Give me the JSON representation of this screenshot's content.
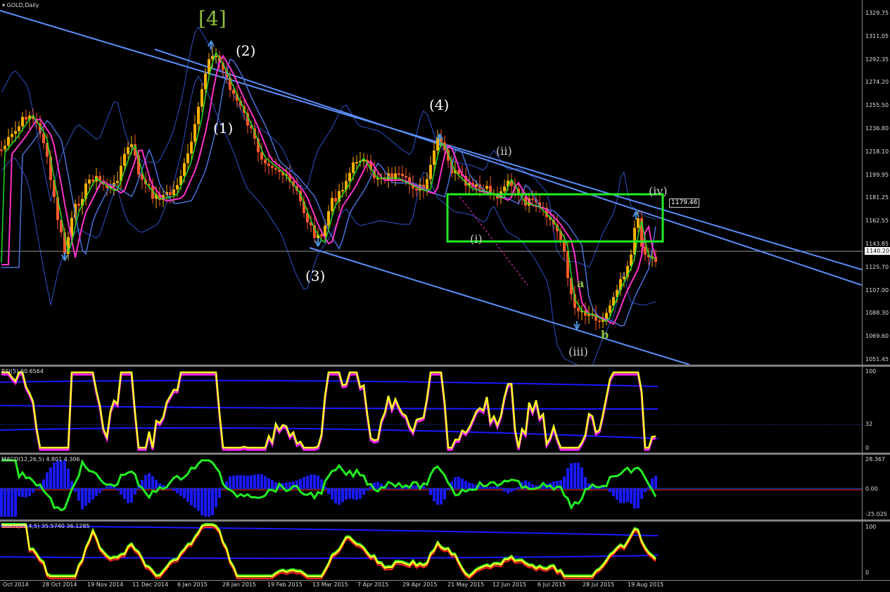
{
  "chart_title": "GOLD,Daily",
  "price_axis": [
    "1329.75",
    "1311.05",
    "1292.35",
    "1274.20",
    "1255.50",
    "1236.80",
    "1218.10",
    "1199.95",
    "1181.25",
    "1162.55",
    "1143.85",
    "1125.70",
    "1107.00",
    "1088.30",
    "1069.60",
    "1051.45"
  ],
  "current_price_label": "1140.20",
  "box_label": "1179.46",
  "wave_labels": {
    "w4_big": "[4]",
    "w2": "(2)",
    "w1": "(1)",
    "w3": "(3)",
    "w4": "(4)",
    "ii": "(ii)",
    "i": "(i)",
    "iii": "(iii)",
    "iv": "(iv)",
    "a": "a",
    "b": "b"
  },
  "rsi": {
    "label": "RSI(5) 60.6564",
    "levels": [
      "100",
      "32",
      "0"
    ]
  },
  "macd": {
    "label": "MACD(12,26,5) 4.801 4.306",
    "levels": [
      "28.367",
      "0.00",
      "-25.025"
    ]
  },
  "stoch": {
    "label": "Stoch(89,4,5) 35.5740 36.1285",
    "levels": [
      "100",
      "0"
    ]
  },
  "x_axis": [
    "Oct 2014",
    "28 Oct 2014",
    "19 Nov 2014",
    "11 Dec 2014",
    "6 Jan 2015",
    "28 Jan 2015",
    "19 Feb 2015",
    "13 Mar 2015",
    "7 Apr 2015",
    "29 Apr 2015",
    "21 May 2015",
    "12 Jun 2015",
    "6 Jul 2015",
    "28 Jul 2015",
    "19 Aug 2015"
  ],
  "colors": {
    "channel": "#5b8ff9",
    "box": "#22ee22",
    "candle_up": "#ffb000",
    "candle_down": "#ff5a2a",
    "ma_green": "#22dd22",
    "ma_magenta": "#ff33cc",
    "rsi_line": "#ffff22",
    "macd_hist": "#1a1aff"
  }
}
